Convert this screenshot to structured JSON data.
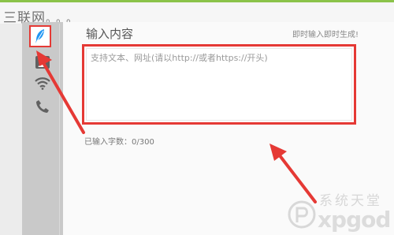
{
  "window": {
    "title_fragment": "三联网",
    "title_dots": "。。。"
  },
  "sidebar": {
    "items": [
      {
        "icon": "feather-icon",
        "active": true
      },
      {
        "icon": "contact-card-icon",
        "active": false
      },
      {
        "icon": "wifi-icon",
        "active": false
      },
      {
        "icon": "phone-icon",
        "active": false
      }
    ]
  },
  "main": {
    "title": "输入内容",
    "realtime_hint": "即时输入即时生成!",
    "input": {
      "value": "",
      "placeholder": "支持文本、网址(请以http://或者https://开头)"
    },
    "char_counter": "已输入字数：0/300"
  },
  "watermark": {
    "top_text": "系统天堂",
    "bottom_text": "xpgod"
  },
  "colors": {
    "top_accent": "#8bc34a",
    "annotation_red": "#e53935",
    "sidebar_bg": "#c9c9c9",
    "icon_active": "#2196f3",
    "icon_gray": "#616161"
  }
}
